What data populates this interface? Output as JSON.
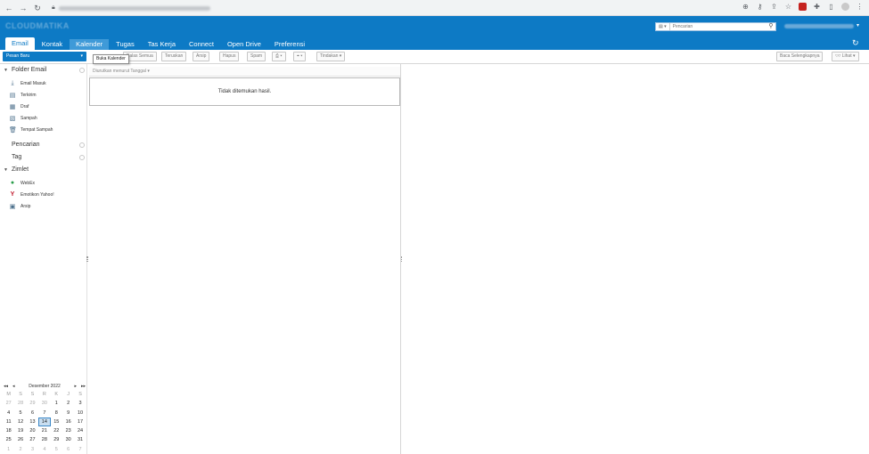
{
  "app": {
    "logo_text": "CLOUDMATIKA"
  },
  "header": {
    "search_scope": "▾",
    "search_placeholder": "Pencarian",
    "tabs": [
      {
        "label": "Email"
      },
      {
        "label": "Kontak"
      },
      {
        "label": "Kalender"
      },
      {
        "label": "Tugas"
      },
      {
        "label": "Tas Kerja"
      },
      {
        "label": "Connect"
      },
      {
        "label": "Open Drive"
      },
      {
        "label": "Preferensi"
      }
    ],
    "active_tab": "Email",
    "hover_tab": "Kalender"
  },
  "toolbar": {
    "new_button": "Pesan Baru",
    "reply_all": "Balas Semua",
    "forward": "Teruskan",
    "archive": "Arsip",
    "delete": "Hapus",
    "spam": "Spam",
    "more": "Tindakan",
    "read_more": "Baca Selengkapnya",
    "view": "Lihat",
    "tooltip": "Buka Kalender"
  },
  "sidebar": {
    "folders_header": "Folder Email",
    "folders": [
      {
        "label": "Email Masuk",
        "icon": "inbox-icon"
      },
      {
        "label": "Terkirim",
        "icon": "sent-icon"
      },
      {
        "label": "Draf",
        "icon": "drafts-icon"
      },
      {
        "label": "Sampah",
        "icon": "junk-icon"
      },
      {
        "label": "Tempat Sampah",
        "icon": "trash-icon"
      }
    ],
    "search_header": "Pencarian",
    "tags_header": "Tag",
    "zimlets_header": "Zimlet",
    "zimlets": [
      {
        "label": "WebEx",
        "icon": "webex-icon"
      },
      {
        "label": "Emotikon Yahoo!",
        "icon": "yahoo-icon"
      },
      {
        "label": "Arsip",
        "icon": "archive-icon"
      }
    ]
  },
  "calendar": {
    "month_label": "Desember 2022",
    "weekdays": [
      "M",
      "S",
      "S",
      "R",
      "K",
      "J",
      "S"
    ],
    "weeks": [
      [
        "27",
        "28",
        "29",
        "30",
        "1",
        "2",
        "3"
      ],
      [
        "4",
        "5",
        "6",
        "7",
        "8",
        "9",
        "10"
      ],
      [
        "11",
        "12",
        "13",
        "14",
        "15",
        "16",
        "17"
      ],
      [
        "18",
        "19",
        "20",
        "21",
        "22",
        "23",
        "24"
      ],
      [
        "25",
        "26",
        "27",
        "28",
        "29",
        "30",
        "31"
      ],
      [
        "1",
        "2",
        "3",
        "4",
        "5",
        "6",
        "7"
      ]
    ],
    "today": "14"
  },
  "list": {
    "sort_label": "Diurutkan menurut Tanggal",
    "empty_message": "Tidak ditemukan hasil."
  },
  "colors": {
    "header_blue": "#0d7ac5",
    "accent": "#3b87c6"
  }
}
